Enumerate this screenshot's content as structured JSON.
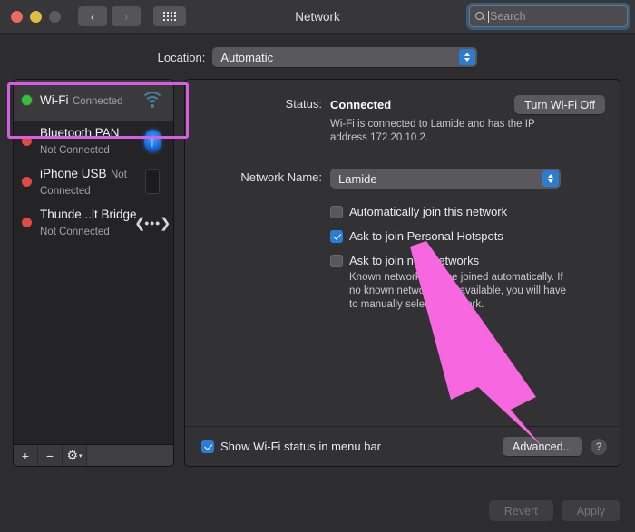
{
  "window": {
    "title": "Network",
    "traffic_lights": [
      "close",
      "minimize",
      "zoom-disabled"
    ],
    "nav_back": "‹",
    "nav_forward": "›"
  },
  "search": {
    "placeholder": "Search",
    "value": "",
    "icon": "search-icon"
  },
  "location": {
    "label": "Location:",
    "value": "Automatic",
    "options": [
      "Automatic"
    ]
  },
  "sidebar": {
    "items": [
      {
        "name": "Wi-Fi",
        "status": "Connected",
        "dot": "green",
        "icon": "wifi-icon",
        "selected": true
      },
      {
        "name": "Bluetooth PAN",
        "status": "Not Connected",
        "dot": "red",
        "icon": "bluetooth-icon",
        "selected": false
      },
      {
        "name": "iPhone USB",
        "status": "Not Connected",
        "dot": "red",
        "icon": "iphone-icon",
        "selected": false
      },
      {
        "name": "Thunde...lt Bridge",
        "status": "Not Connected",
        "dot": "red",
        "icon": "thunderbolt-bridge-icon",
        "selected": false
      }
    ],
    "toolbar": {
      "add": "+",
      "remove": "−",
      "gear": "gear-icon",
      "gear_chevron": "▾"
    }
  },
  "main": {
    "status": {
      "label": "Status:",
      "value": "Connected",
      "toggle_button": "Turn Wi-Fi Off",
      "description": "Wi-Fi is connected to Lamide and has the IP address 172.20.10.2."
    },
    "network_name": {
      "label": "Network Name:",
      "value": "Lamide",
      "options": [
        "Lamide"
      ]
    },
    "options": [
      {
        "label": "Automatically join this network",
        "checked": false
      },
      {
        "label": "Ask to join Personal Hotspots",
        "checked": true
      },
      {
        "label": "Ask to join new networks",
        "checked": false
      }
    ],
    "options_note": "Known networks will be joined automatically. If no known networks are available, you will have to manually select a network.",
    "show_status": {
      "label": "Show Wi-Fi status in menu bar",
      "checked": true
    },
    "advanced_button": "Advanced...",
    "help_button": "?"
  },
  "footer": {
    "revert": "Revert",
    "apply": "Apply",
    "revert_enabled": false,
    "apply_enabled": false
  },
  "annotations": {
    "highlight_color": "#d45fe0",
    "arrow_color": "#f768e0",
    "arrow_target": "advanced-button"
  }
}
